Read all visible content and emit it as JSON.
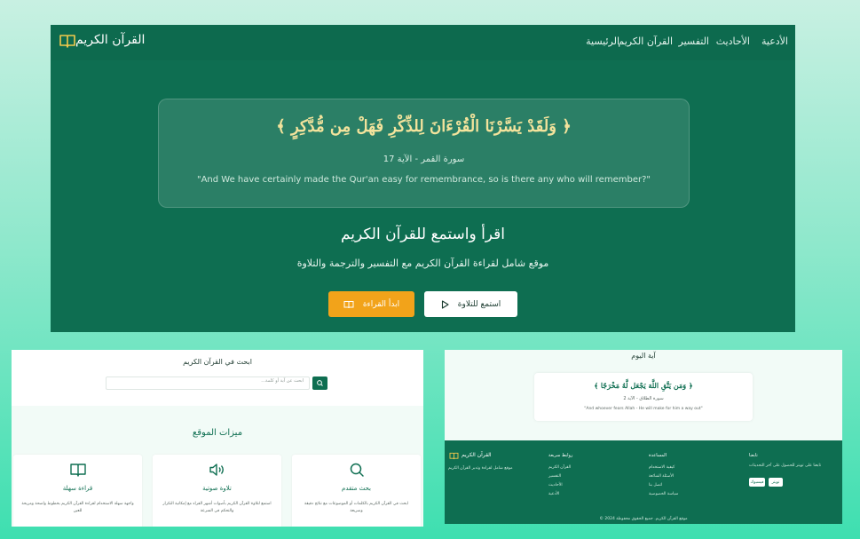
{
  "nav": {
    "brand": "القرآن الكريم",
    "items": [
      "الرئيسية",
      "القرآن الكريم",
      "التفسير",
      "الأحاديث",
      "الأدعية"
    ]
  },
  "hero": {
    "verse_ar": "﴿ وَلَقَدْ يَسَّرْنَا الْقُرْءَانَ لِلذِّكْرِ فَهَلْ مِن مُّدَّكِرٍ ﴾",
    "verse_ref": "سورة القمر - الآية 17",
    "verse_en": "\"And We have certainly made the Qur'an easy for remembrance, so is there any who will remember?\"",
    "title": "اقرأ واستمع للقرآن الكريم",
    "subtitle": "موقع شامل لقراءة القرآن الكريم مع التفسير والترجمة والتلاوة",
    "read_button": "ابدأ القراءة",
    "listen_button": "استمع للتلاوة"
  },
  "search": {
    "title": "ابحث في القرآن الكريم",
    "placeholder": "ابحث عن آية أو كلمة..."
  },
  "features": {
    "title": "ميزات الموقع",
    "cards": [
      {
        "title": "قراءة سهلة",
        "desc": "واجهة سهلة الاستخدام لقراءة القرآن الكريم بخطوط واضحة ومريحة للعين",
        "icon": "book-icon"
      },
      {
        "title": "تلاوة صوتية",
        "desc": "استمع لتلاوة القرآن الكريم بأصوات أشهر القراء مع إمكانية التكرار والتحكم في السرعة",
        "icon": "speaker-icon"
      },
      {
        "title": "بحث متقدم",
        "desc": "ابحث في القرآن الكريم بالكلمات أو الموضوعات مع نتائج دقيقة وسريعة",
        "icon": "search-icon"
      }
    ]
  },
  "daily": {
    "title": "آية اليوم",
    "verse_ar": "﴿ وَمَن يَتَّقِ اللَّهَ يَجْعَل لَّهُ مَخْرَجًا ﴾",
    "verse_ref": "سورة الطلاق - الآية 2",
    "verse_en": "\"And whoever fears Allah - He will make for him a way out\""
  },
  "footer": {
    "brand": "القرآن الكريم",
    "desc": "موقع شامل لقراءة وتدبر القرآن الكريم",
    "quick_links_title": "روابط سريعة",
    "quick_links": [
      "القرآن الكريم",
      "التفسير",
      "الأحاديث",
      "الأدعية"
    ],
    "help_title": "المساعدة",
    "help_links": [
      "كيفية الاستخدام",
      "الأسئلة الشائعة",
      "اتصل بنا",
      "سياسة الخصوصية"
    ],
    "follow_title": "تابعنا",
    "follow_text": "تابعنا على تويتر للحصول على آخر التحديثات",
    "twitter": "تويتر",
    "facebook": "فيسبوك",
    "copyright": "© 2024 موقع القرآن الكريم. جميع الحقوق محفوظة"
  },
  "colors": {
    "primary": "#0e6e51",
    "accent": "#f2a31a",
    "verse_gold": "#f3e39c"
  }
}
